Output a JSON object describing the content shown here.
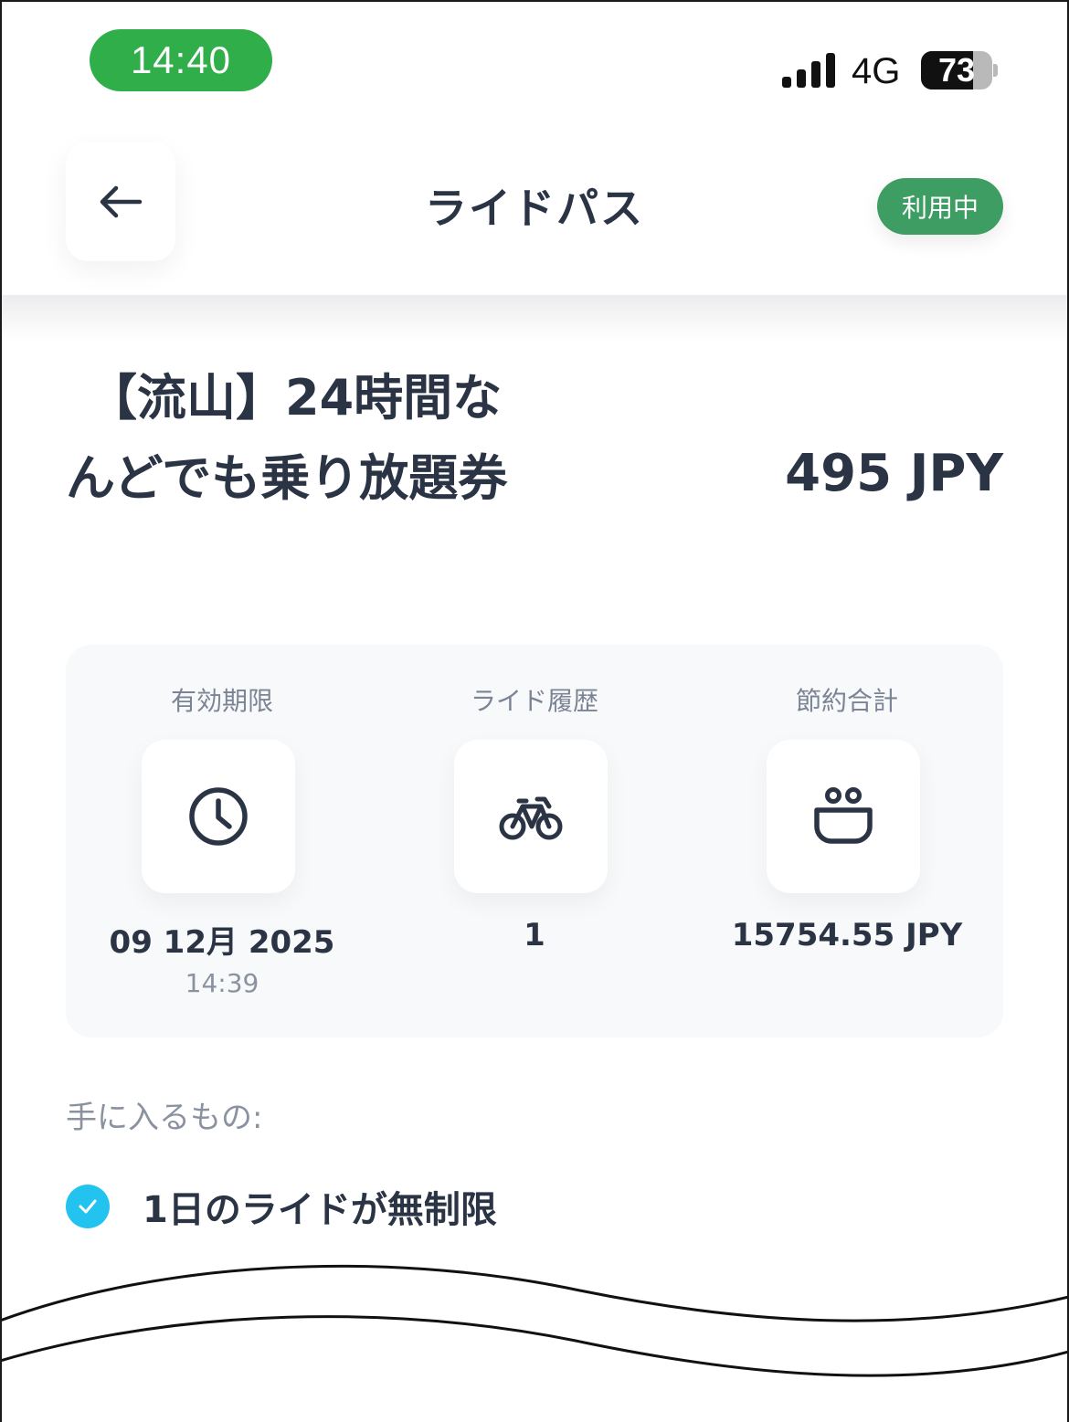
{
  "status_bar": {
    "time": "14:40",
    "network": "4G",
    "battery": "73",
    "battery_level": 0.73
  },
  "header": {
    "title": "ライドパス",
    "status_badge": "利用中",
    "back_icon": "arrow-left-icon"
  },
  "pass": {
    "title_line1": "【流山】24時間な",
    "title_line2": "んどでも乗り放題券",
    "price": "495 JPY"
  },
  "stats": [
    {
      "label": "有効期限",
      "icon": "clock-icon",
      "value": "09 12月 2025",
      "sub": "14:39"
    },
    {
      "label": "ライド履歴",
      "icon": "bicycle-icon",
      "value": "1",
      "sub": ""
    },
    {
      "label": "節約合計",
      "icon": "wallet-icon",
      "value": "15754.55 JPY",
      "sub": ""
    }
  ],
  "benefits": {
    "heading": "手に入るもの:",
    "items": [
      {
        "icon": "check-icon",
        "label": "1日のライドが無制限"
      }
    ]
  },
  "colors": {
    "time_pill": "#2fae4a",
    "status_badge": "#3e9d63",
    "check": "#22c3ef",
    "text": "#2b3445"
  }
}
